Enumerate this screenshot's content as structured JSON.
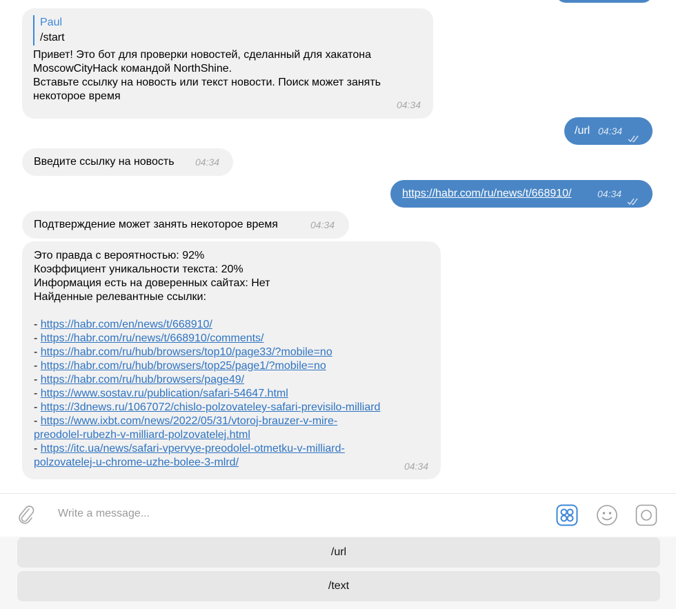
{
  "messages": {
    "top_partial_time": "",
    "start_reply": {
      "reply_name": "Paul",
      "reply_text": "/start",
      "lines": [
        "Привет! Это бот для проверки новостей, сделанный для хакатона",
        "MoscowCityHack командой NorthShine.",
        "Вставьте ссылку на новость или текст новости. Поиск может занять",
        "некоторое время"
      ],
      "time": "04:34"
    },
    "url_command": {
      "text": "/url",
      "time": "04:34"
    },
    "enter_link": {
      "text": "Введите ссылку на новость",
      "time": "04:34"
    },
    "sent_link": {
      "text": "https://habr.com/ru/news/t/668910/",
      "time": "04:34"
    },
    "confirm": {
      "text": "Подтверждение может занять некоторое время",
      "time": "04:34"
    },
    "result": {
      "lines": [
        "Это правда с вероятностью: 92%",
        "Коэффициент уникальности текста: 20%",
        "Информация есть на доверенных сайтах: Нет",
        "Найденные релевантные ссылки:"
      ],
      "links": [
        {
          "prefix": "- ",
          "text": "https://habr.com/en/news/t/668910/"
        },
        {
          "prefix": "- ",
          "text": "https://habr.com/ru/news/t/668910/comments/"
        },
        {
          "prefix": "- ",
          "text": "https://habr.com/ru/hub/browsers/top10/page33/?mobile=no"
        },
        {
          "prefix": "- ",
          "text": "https://habr.com/ru/hub/browsers/top25/page1/?mobile=no"
        },
        {
          "prefix": "- ",
          "text": "https://habr.com/ru/hub/browsers/page49/"
        },
        {
          "prefix": "- ",
          "text": "https://www.sostav.ru/publication/safari-54647.html"
        },
        {
          "prefix": "- ",
          "text": "https://3dnews.ru/1067072/chislo-polzovateley-safari-previsilo-milliard"
        },
        {
          "prefix": "- ",
          "text": "https://www.ixbt.com/news/2022/05/31/vtoroj-brauzer-v-mire-",
          "cont": "preodolel-rubezh-v-milliard-polzovatelej.html"
        },
        {
          "prefix": "- ",
          "text": "https://itc.ua/news/safari-vpervye-preodolel-otmetku-v-milliard-",
          "cont": "polzovatelej-u-chrome-uzhe-bolee-3-mlrd/"
        }
      ],
      "time": "04:34"
    }
  },
  "composer": {
    "placeholder": "Write a message...",
    "icons": [
      "paperclip-icon",
      "bot-commands-icon",
      "emoji-icon",
      "camera-icon"
    ],
    "accent_color": "#3e87d6"
  },
  "keyboard": {
    "buttons": [
      "/url",
      "/text"
    ]
  },
  "colors": {
    "outgoing_bubble": "#4a86c5",
    "incoming_bubble": "#f1f1f2",
    "link": "#2f74c0"
  }
}
